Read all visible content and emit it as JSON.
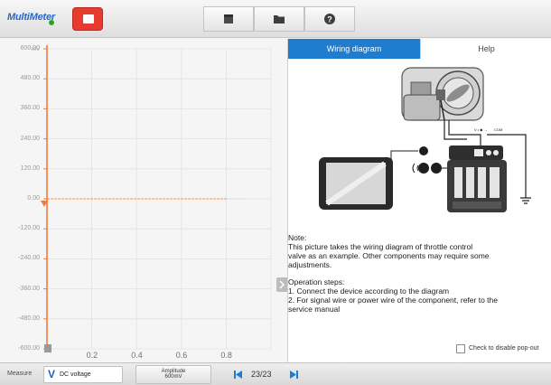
{
  "app": {
    "title": "MultiMeter"
  },
  "toolbar": {
    "stop_icon": "stop-record-icon",
    "buttons": [
      {
        "name": "report",
        "icon": "document-icon"
      },
      {
        "name": "files",
        "icon": "folder-icon"
      },
      {
        "name": "help",
        "icon": "help-circle-icon"
      }
    ]
  },
  "chart_data": {
    "type": "line",
    "title": "",
    "xlabel": "",
    "ylabel": "mV",
    "y_ticks": [
      "600.00",
      "480.00",
      "360.00",
      "240.00",
      "120.00",
      "0.00",
      "-120.00",
      "-240.00",
      "-360.00",
      "-480.00",
      "-600.00"
    ],
    "x_ticks": [
      "0.2",
      "0.4",
      "0.6",
      "0.8"
    ],
    "ylim": [
      -600,
      600
    ],
    "xlim": [
      0,
      1.0
    ],
    "grid": true,
    "series": [
      {
        "x": [
          0.0,
          0.8
        ],
        "y": [
          0,
          0
        ]
      }
    ],
    "colors": {
      "axis": "#ef7d3c",
      "trace": "#ef7d3c",
      "marker": "#ef7d3c"
    }
  },
  "panel": {
    "tabs": [
      {
        "label": "Wiring diagram",
        "active": true
      },
      {
        "label": "Help",
        "active": false
      }
    ],
    "diagram_labels": {
      "v_label": "V • ◆ →",
      "com_label": "COM"
    },
    "note_title": "Note:",
    "note_lines": [
      "This picture takes the wiring diagram of throttle control",
      "valve as an example. Other components may require some",
      "adjustments."
    ],
    "steps_title": "Operation steps:",
    "step_lines": [
      "1. Connect the device according to the diagram",
      "2. For signal wire or power wire of the component, refer to the",
      "service manual"
    ],
    "popout_checkbox": {
      "label": "Check to disable pop-out",
      "checked": false
    }
  },
  "bottombar": {
    "measure_label": "Measure",
    "measure_value": "DC voltage",
    "amplitude_label": "Amplitude",
    "amplitude_value": "600mV",
    "page_indicator": "23/23"
  },
  "colors": {
    "accent": "#1f7ccf",
    "stop": "#e63b2e"
  }
}
